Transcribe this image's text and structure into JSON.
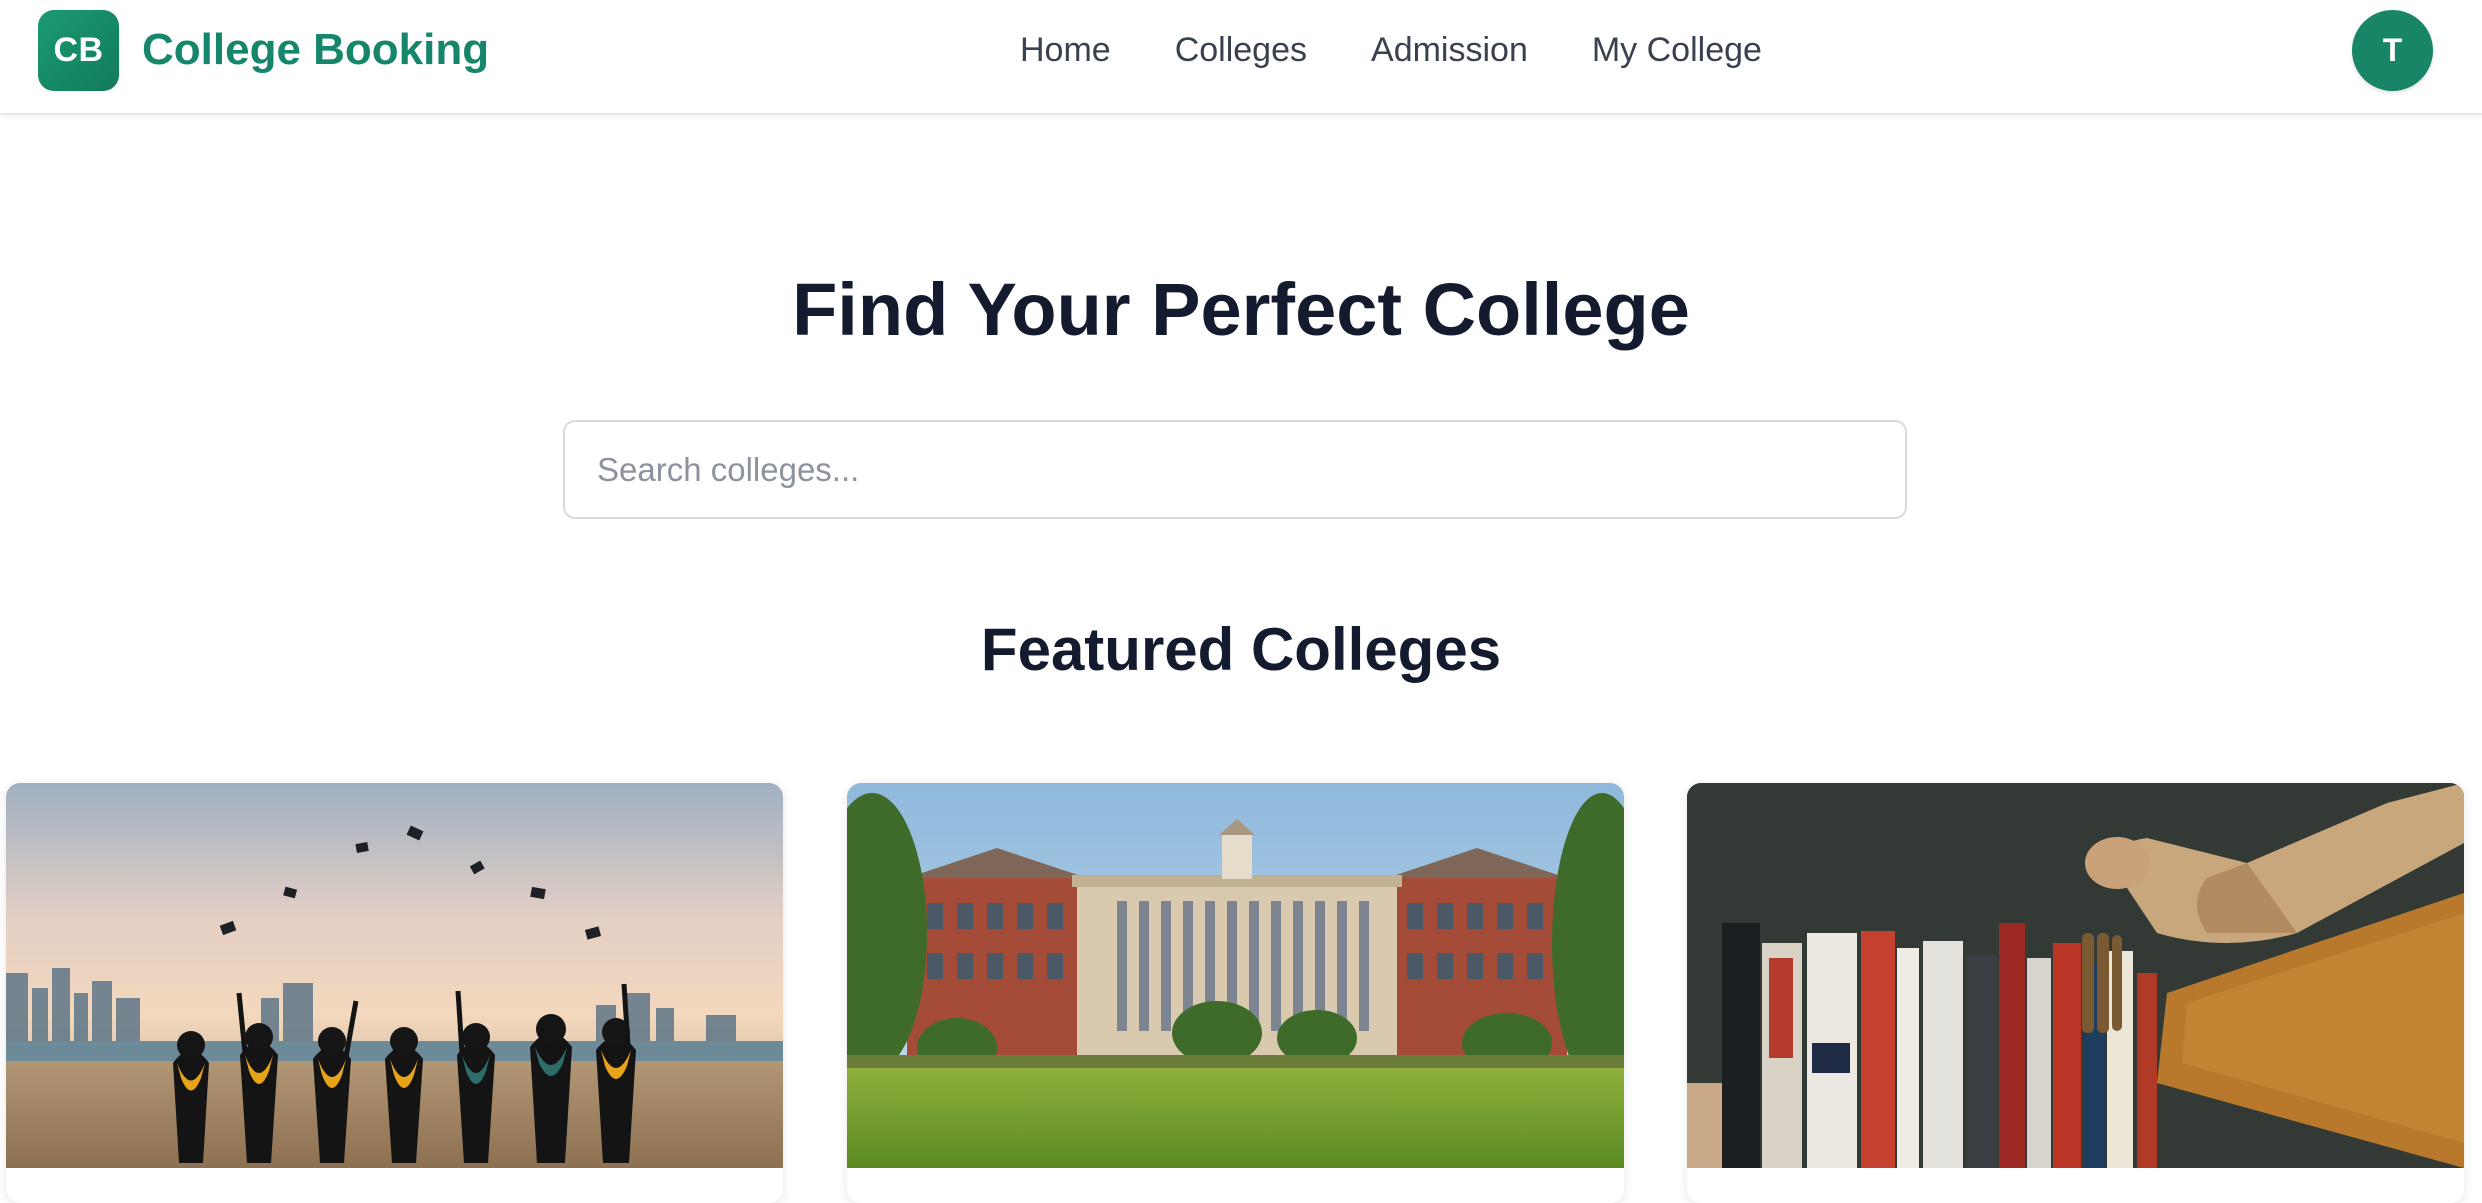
{
  "header": {
    "logo_initials": "CB",
    "brand": "College Booking",
    "nav": [
      {
        "label": "Home"
      },
      {
        "label": "Colleges"
      },
      {
        "label": "Admission"
      },
      {
        "label": "My College"
      }
    ],
    "avatar_initial": "T"
  },
  "hero": {
    "title": "Find Your Perfect College",
    "search_placeholder": "Search colleges..."
  },
  "featured": {
    "title": "Featured Colleges",
    "cards": [
      {
        "image": "graduates-throwing-caps-photo"
      },
      {
        "image": "campus-building-lawn-photo"
      },
      {
        "image": "hand-picking-book-from-shelf-photo"
      }
    ]
  },
  "colors": {
    "brand": "#16866a",
    "heading": "#141b2e",
    "nav_text": "#39414f"
  }
}
